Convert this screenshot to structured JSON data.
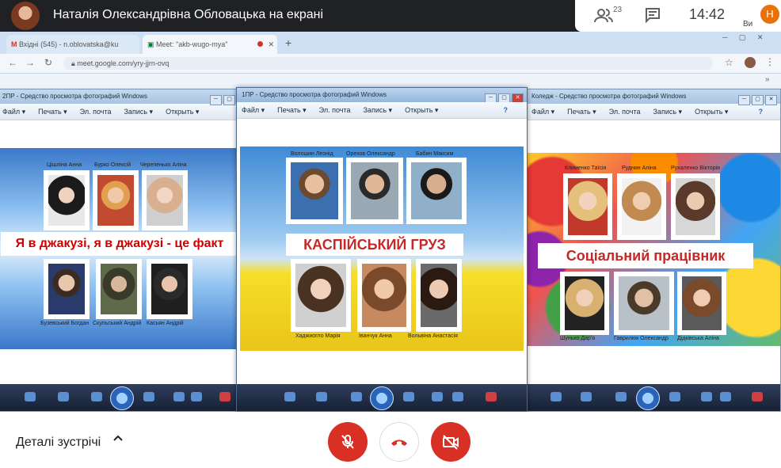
{
  "meeting": {
    "presenter_title": "Наталія Олександрівна Обловацька на екрані",
    "participant_count": "23",
    "time": "14:42",
    "self_avatar_letter": "Н",
    "self_label": "Ви"
  },
  "browser": {
    "tabs": [
      {
        "label": "Вхідні (545) - n.oblovatska@ku"
      },
      {
        "label": "Meet: \"akb-wugo-mya\""
      }
    ],
    "url": "meet.google.com/yry-jjrn-ovq"
  },
  "viewers": [
    {
      "title": "2ПР - Средство просмотра фотографий Windows",
      "menu": [
        "Файл ▾",
        "Печать ▾",
        "Эл. почта",
        "Запись ▾",
        "Открыть ▾"
      ],
      "slide": {
        "banner": "Я в джакузі, я в джакузі - це факт",
        "top_names": [
          "Цішліна Анна",
          "Бурко Олексій",
          "Черепенько Аліна"
        ],
        "bottom_names": [
          "Бузевський Богдан",
          "Скульський Андрій",
          "Касьян Андрій"
        ]
      }
    },
    {
      "title": "1ПР - Средство просмотра фотографий Windows",
      "menu": [
        "Файл ▾",
        "Печать ▾",
        "Эл. почта",
        "Запись ▾",
        "Открыть ▾"
      ],
      "slide": {
        "banner": "КАСПІЙСЬКИЙ  ГРУЗ",
        "top_names": [
          "Волошин Леонід",
          "Орехов Олександр",
          "Бабин Максим"
        ],
        "bottom_names": [
          "Хаджиогло Марія",
          "Іванчук Анна",
          "Вольвіна Анастасія"
        ]
      }
    },
    {
      "title": "Коледж - Средство просмотра фотографий Windows",
      "menu": [
        "Файл ▾",
        "Печать ▾",
        "Эл. почта",
        "Запись ▾",
        "Открыть ▾"
      ],
      "slide": {
        "banner": "Соціальний  працівник",
        "top_names": [
          "Клименко Таїсія",
          "Руднин Аліна",
          "Рухаленко Вікторія"
        ],
        "bottom_names": [
          "Шунько Дар'я",
          "Гаврилюк Олександр",
          "Дідківська Аліна"
        ]
      }
    }
  ],
  "bottom": {
    "details_label": "Деталі зустрічі"
  },
  "colors": {
    "accent_red": "#d93025",
    "dark_bar": "#202124",
    "avatar_orange": "#e8710a"
  }
}
